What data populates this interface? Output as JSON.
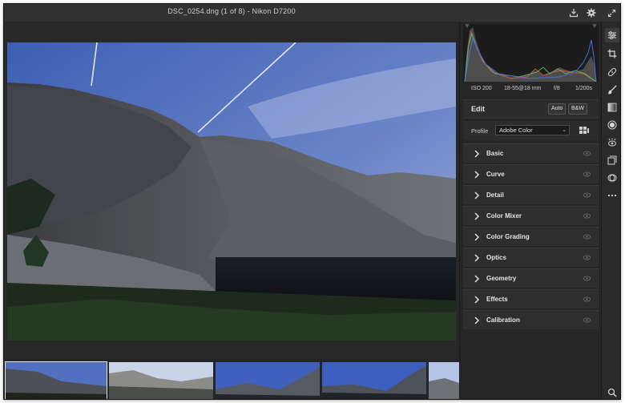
{
  "window": {
    "title": "DSC_0254.dng (1 of 8)  -  Nikon D7200"
  },
  "titlebar_icons": [
    "save-download-icon",
    "gear-icon",
    "expand-icon"
  ],
  "exif": {
    "iso": "ISO 200",
    "lens": "18-55@18 mm",
    "aperture": "f/8",
    "shutter": "1/200s"
  },
  "edit": {
    "title": "Edit",
    "auto_label": "Auto",
    "bw_label": "B&W"
  },
  "profile": {
    "label": "Profile",
    "value": "Adobe Color"
  },
  "sections": [
    {
      "label": "Basic"
    },
    {
      "label": "Curve"
    },
    {
      "label": "Detail"
    },
    {
      "label": "Color Mixer"
    },
    {
      "label": "Color Grading"
    },
    {
      "label": "Optics"
    },
    {
      "label": "Geometry"
    },
    {
      "label": "Effects"
    },
    {
      "label": "Calibration"
    }
  ],
  "tools": [
    "edit-sliders-icon",
    "crop-icon",
    "healing-icon",
    "brush-icon",
    "linear-gradient-icon",
    "radial-filter-icon",
    "red-eye-icon",
    "presets-icon",
    "snapshots-icon",
    "more-icon",
    "zoom-icon"
  ],
  "colors": {
    "panel_bg": "#262626",
    "section_bg": "#2e2e2e",
    "canvas_bg": "#282828",
    "histogram_red": "#d0504b",
    "histogram_green": "#57b35a",
    "histogram_blue": "#4a6fd8"
  }
}
